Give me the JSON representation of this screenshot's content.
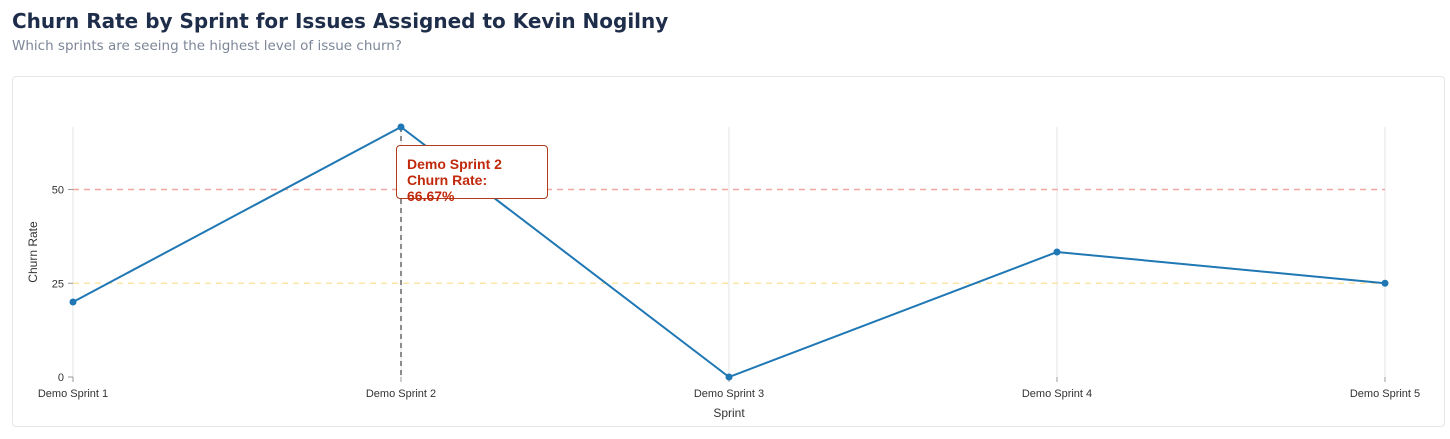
{
  "header": {
    "title": "Churn Rate by Sprint for Issues Assigned to Kevin Nogilny",
    "subtitle": "Which sprints are seeing the highest level of issue churn?"
  },
  "tooltip": {
    "line1": "Demo Sprint 2",
    "line2": "Churn Rate: 66.67%"
  },
  "chart_data": {
    "type": "line",
    "title": "Churn Rate by Sprint for Issues Assigned to Kevin Nogilny",
    "subtitle": "Which sprints are seeing the highest level of issue churn?",
    "xlabel": "Sprint",
    "ylabel": "Churn Rate",
    "categories": [
      "Demo Sprint 1",
      "Demo Sprint 2",
      "Demo Sprint 3",
      "Demo Sprint 4",
      "Demo Sprint 5"
    ],
    "series": [
      {
        "values": [
          20,
          66.67,
          0,
          33.33,
          25
        ],
        "color": "#1f77b4"
      }
    ],
    "yticks": [
      0,
      25,
      50
    ],
    "ylim": [
      0,
      66.67
    ],
    "reference_lines": [
      {
        "value": 50,
        "color": "#f4a7a0"
      },
      {
        "value": 25,
        "color": "#fde5a8"
      }
    ],
    "highlighted_category": "Demo Sprint 2",
    "grid": "vertical"
  }
}
